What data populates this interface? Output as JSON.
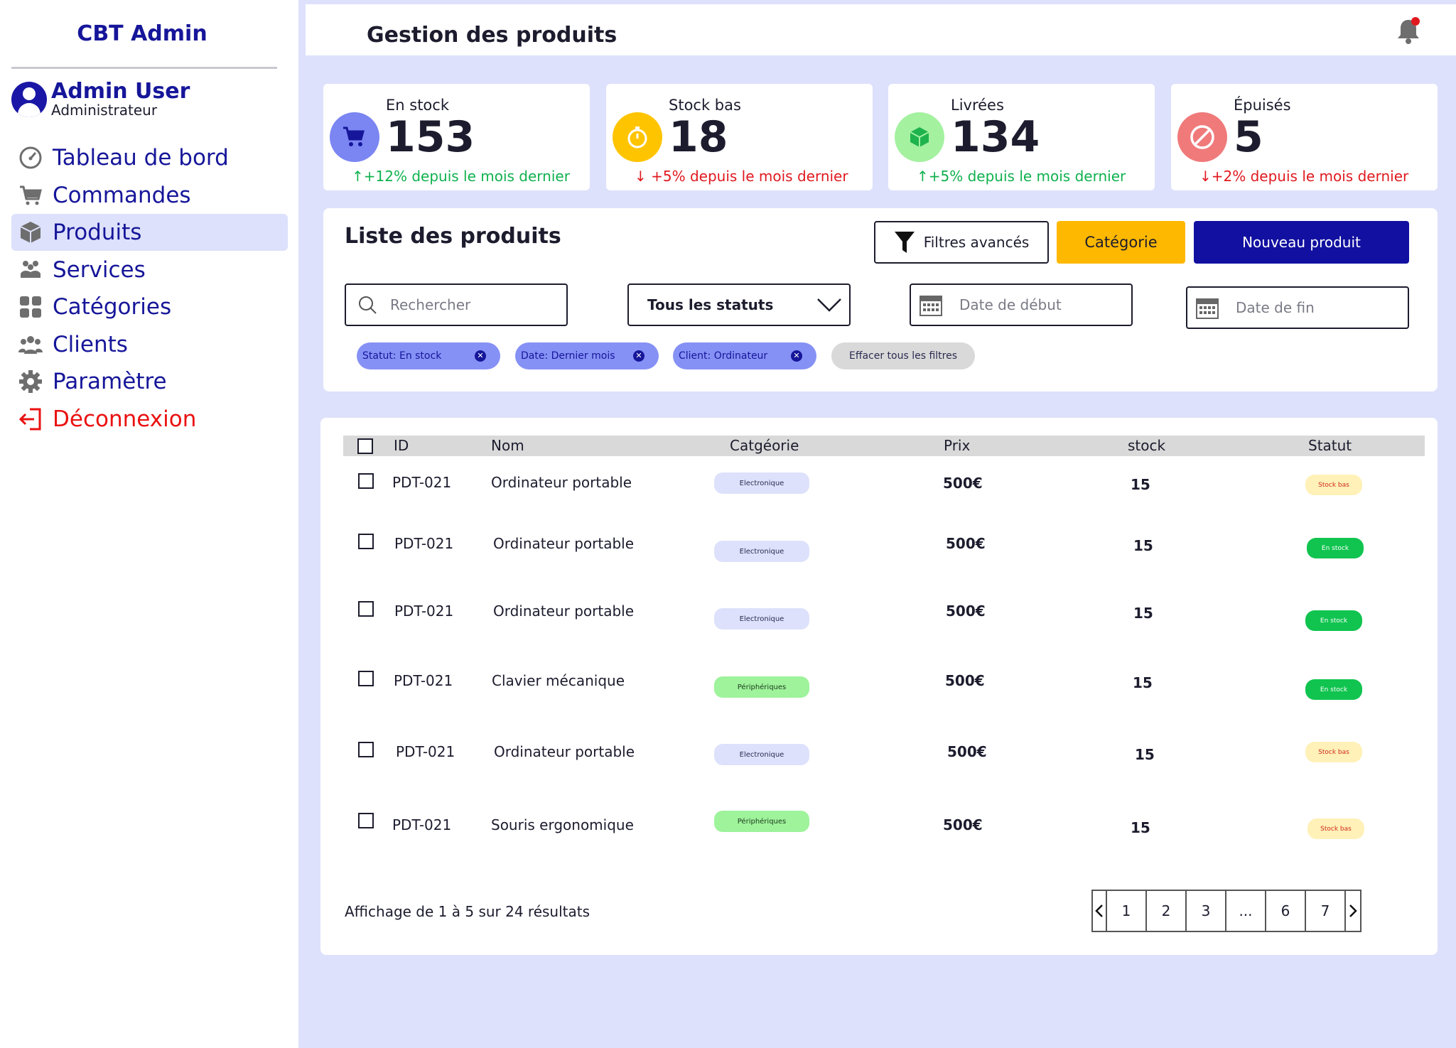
{
  "sidebar": {
    "brand": "CBT Admin",
    "user": {
      "name": "Admin User",
      "role": "Administrateur"
    },
    "items": [
      {
        "label": "Tableau de bord",
        "icon": "dashboard-icon",
        "active": false
      },
      {
        "label": "Commandes",
        "icon": "cart-icon",
        "active": false
      },
      {
        "label": "Produits",
        "icon": "box-icon",
        "active": true
      },
      {
        "label": "Services",
        "icon": "services-icon",
        "active": false
      },
      {
        "label": "Catégories",
        "icon": "grid-icon",
        "active": false
      },
      {
        "label": "Clients",
        "icon": "users-icon",
        "active": false
      },
      {
        "label": "Paramètre",
        "icon": "gear-icon",
        "active": false
      },
      {
        "label": "Déconnexion",
        "icon": "logout-icon",
        "active": false
      }
    ]
  },
  "header": {
    "title": "Gestion des produits",
    "notification_badge": "1"
  },
  "stats": [
    {
      "label": "En stock",
      "value": "153",
      "delta": "+12% depuis le mois dernier",
      "trend": "up",
      "icon": "cart-icon",
      "color": "#7b86f2"
    },
    {
      "label": "Stock bas",
      "value": "18",
      "delta": "+5% depuis le mois dernier",
      "trend": "down",
      "icon": "stopwatch-icon",
      "color": "#ffc400"
    },
    {
      "label": "Livrées",
      "value": "134",
      "delta": "+5% depuis le mois dernier",
      "trend": "up",
      "icon": "package-icon",
      "color": "#a4f1a0"
    },
    {
      "label": "Épuisés",
      "value": "5",
      "delta": "+2% depuis le mois dernier",
      "trend": "down",
      "icon": "ban-icon",
      "color": "#f07a7a"
    }
  ],
  "list": {
    "title": "Liste des produits",
    "buttons": {
      "filters": "Filtres avancés",
      "category": "Catégorie",
      "new": "Nouveau produit"
    },
    "search_placeholder": "Rechercher",
    "status_select": "Tous les statuts",
    "date_start_placeholder": "Date de début",
    "date_end_placeholder": "Date de fin",
    "chips": [
      "Statut: En stock",
      "Date: Dernier mois",
      "Client: Ordinateur"
    ],
    "clear_filters": "Effacer tous les filtres"
  },
  "table": {
    "columns": [
      "ID",
      "Nom",
      "Catgéorie",
      "Prix",
      "stock",
      "Statut"
    ],
    "rows": [
      {
        "id": "PDT-021",
        "name": "Ordinateur portable",
        "category": "Electronique",
        "price": "500€",
        "stock": "15",
        "status": "Stock bas"
      },
      {
        "id": "PDT-021",
        "name": "Ordinateur portable",
        "category": "Electronique",
        "price": "500€",
        "stock": "15",
        "status": "En stock"
      },
      {
        "id": "PDT-021",
        "name": "Ordinateur portable",
        "category": "Electronique",
        "price": "500€",
        "stock": "15",
        "status": "En stock"
      },
      {
        "id": "PDT-021",
        "name": "Clavier mécanique",
        "category": "Périphériques",
        "price": "500€",
        "stock": "15",
        "status": "En stock"
      },
      {
        "id": "PDT-021",
        "name": "Ordinateur portable",
        "category": "Electronique",
        "price": "500€",
        "stock": "15",
        "status": "Stock bas"
      },
      {
        "id": "PDT-021",
        "name": "Souris ergonomique",
        "category": "Périphériques",
        "price": "500€",
        "stock": "15",
        "status": "Stock bas"
      }
    ],
    "results_text": "Affichage de 1 à 5 sur 24 résultats",
    "pagination": [
      "1",
      "2",
      "3",
      "...",
      "6",
      "7"
    ]
  }
}
